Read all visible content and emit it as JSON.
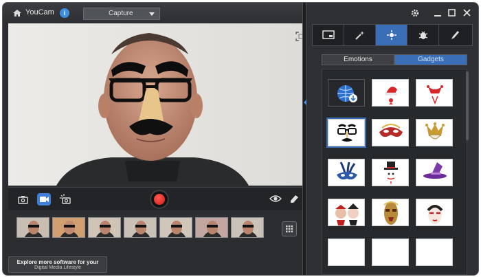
{
  "app": {
    "title": "YouCam",
    "info_badge": "i"
  },
  "mode_select": {
    "value": "Capture"
  },
  "promo": {
    "line1": "Explore more software for your",
    "line2": "Digital Media Lifestyle"
  },
  "panel": {
    "tabs": [
      {
        "id": "frames",
        "icon": "frame-icon"
      },
      {
        "id": "effects",
        "icon": "magic-wand-icon"
      },
      {
        "id": "avatars",
        "icon": "sparkle-face-icon",
        "active": true
      },
      {
        "id": "distortion",
        "icon": "bug-icon"
      },
      {
        "id": "draw",
        "icon": "brush-icon"
      }
    ],
    "subtabs": {
      "emotions": "Emotions",
      "gadgets": "Gadgets",
      "active": "gadgets"
    }
  },
  "gallery": {
    "items": [
      {
        "name": "download-more",
        "icon": "globe-download-icon"
      },
      {
        "name": "santa-hat"
      },
      {
        "name": "jester-hat"
      },
      {
        "name": "groucho-glasses",
        "selected": true
      },
      {
        "name": "venetian-mask"
      },
      {
        "name": "jester-mask"
      },
      {
        "name": "feather-mask"
      },
      {
        "name": "top-hat-face"
      },
      {
        "name": "witch-hat"
      },
      {
        "name": "harlequins"
      },
      {
        "name": "tribal-mask"
      },
      {
        "name": "geisha-mask"
      }
    ]
  },
  "colors": {
    "accent": "#3a6fb8",
    "record": "#d01b14",
    "window": "#2b2d30"
  }
}
